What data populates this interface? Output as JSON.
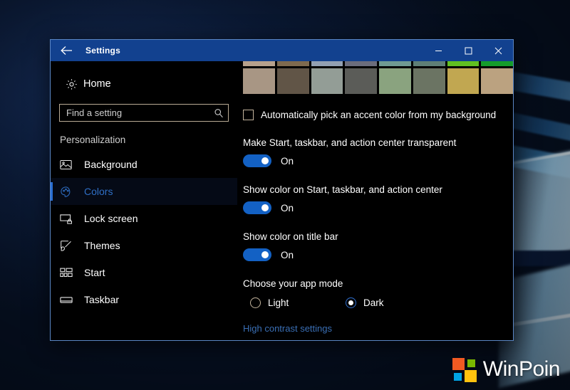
{
  "window": {
    "title": "Settings",
    "back_icon": "back-arrow-icon",
    "minimize_label": "–",
    "maximize_label": "□",
    "close_label": "✕"
  },
  "sidebar": {
    "home_label": "Home",
    "home_icon": "gear-icon",
    "search": {
      "placeholder": "Find a setting",
      "value": "",
      "icon": "search-icon"
    },
    "section_title": "Personalization",
    "items": [
      {
        "label": "Background",
        "icon": "picture-icon",
        "selected": false
      },
      {
        "label": "Colors",
        "icon": "palette-icon",
        "selected": true
      },
      {
        "label": "Lock screen",
        "icon": "lock-screen-icon",
        "selected": false
      },
      {
        "label": "Themes",
        "icon": "brush-icon",
        "selected": false
      },
      {
        "label": "Start",
        "icon": "start-tiles-icon",
        "selected": false
      },
      {
        "label": "Taskbar",
        "icon": "taskbar-icon",
        "selected": false
      }
    ]
  },
  "main": {
    "swatches_clipped_row": [
      "#b7a18c",
      "#7e6a4f",
      "#93a0b2",
      "#6b6d7c",
      "#6f9a92",
      "#5e7f76",
      "#61c021",
      "#149c2b"
    ],
    "swatches_row": [
      "#a89684",
      "#615547",
      "#939d96",
      "#5b5c58",
      "#8aa37f",
      "#6b7463",
      "#c1a751",
      "#bba280"
    ],
    "auto_accent": {
      "label": "Automatically pick an accent color from my background",
      "checked": false
    },
    "settings": [
      {
        "label": "Make Start, taskbar, and action center transparent",
        "state": "On",
        "on": true
      },
      {
        "label": "Show color on Start, taskbar, and action center",
        "state": "On",
        "on": true
      },
      {
        "label": "Show color on title bar",
        "state": "On",
        "on": true
      }
    ],
    "app_mode": {
      "label": "Choose your app mode",
      "options": [
        {
          "label": "Light",
          "selected": false
        },
        {
          "label": "Dark",
          "selected": true
        }
      ]
    },
    "high_contrast_link": "High contrast settings"
  },
  "watermark": {
    "text": "WinPoin",
    "logo_colors": {
      "top_left": "#f15a22",
      "top_right": "#7ab800",
      "bottom_left": "#00a4e4",
      "bottom_right": "#ffc20e"
    }
  },
  "theme": {
    "accent": "#12418f",
    "toggle_on": "#1361c4",
    "selected_text": "#2f6fc6",
    "link": "#3a6fb5",
    "control_border": "#c3b49d",
    "window_bg": "#000000"
  }
}
